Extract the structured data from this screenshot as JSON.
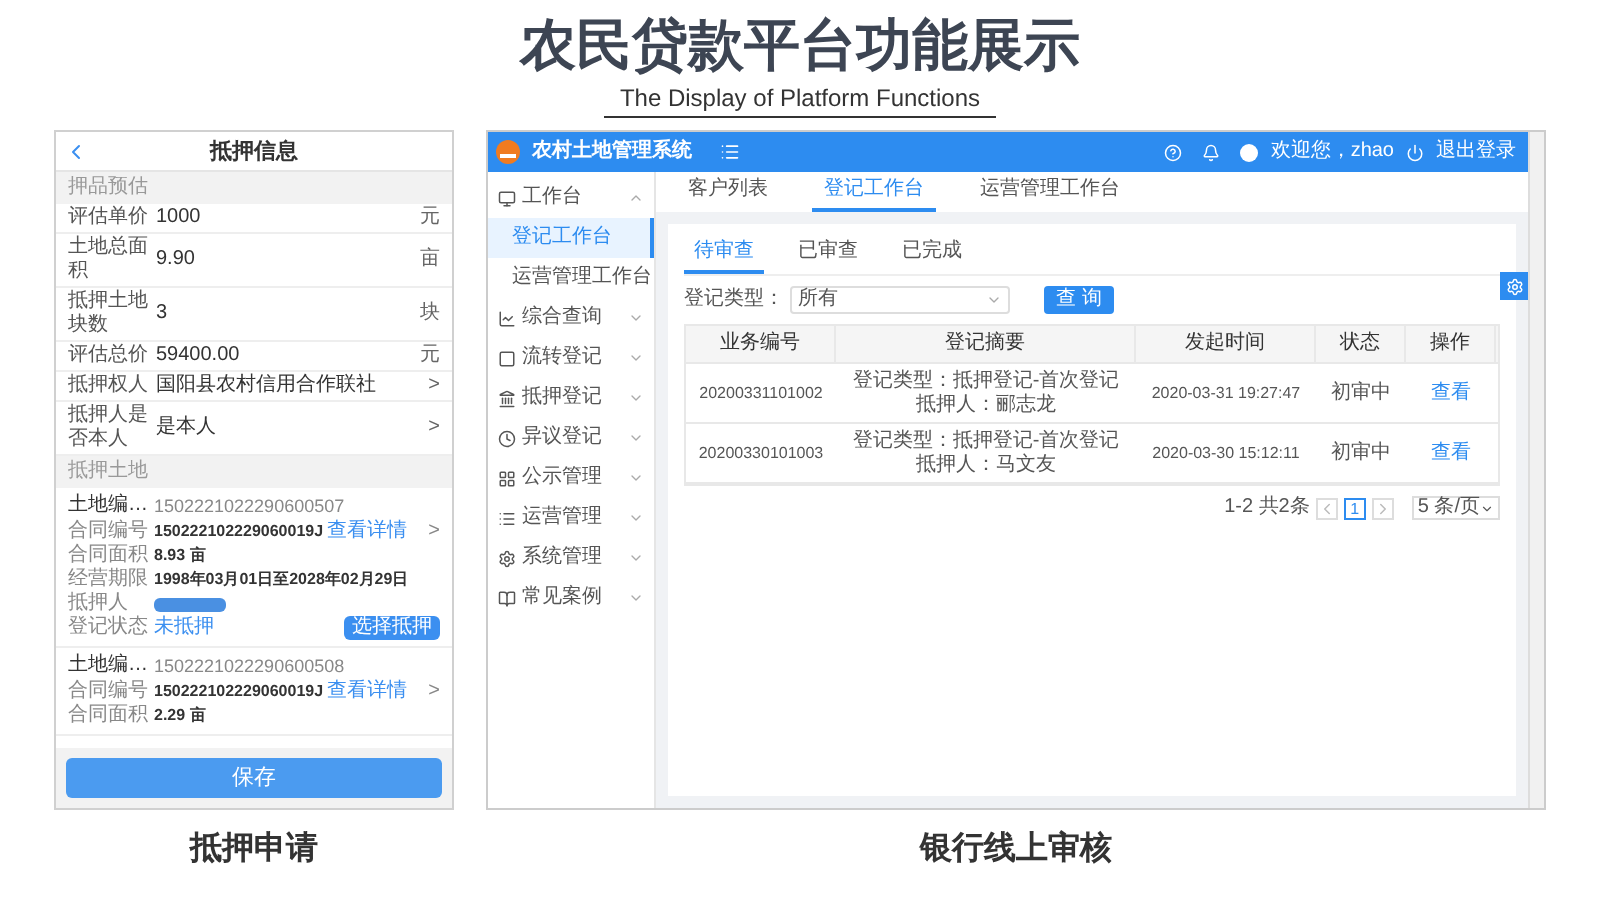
{
  "slide": {
    "title": "农民贷款平台功能展示",
    "subtitle": "The Display of Platform Functions"
  },
  "mobile": {
    "title": "抵押信息",
    "caption": "抵押申请",
    "estimate_heading": "押品预估",
    "fields": [
      {
        "label": "评估单价",
        "value": "1000",
        "unit": "元"
      },
      {
        "label": "土地总面积",
        "value": "9.90",
        "unit": "亩"
      },
      {
        "label": "抵押土地块数",
        "value": "3",
        "unit": "块"
      },
      {
        "label": "评估总价",
        "value": "59400.00",
        "unit": "元"
      },
      {
        "label": "抵押权人",
        "value": "国阳县农村信用合作联社",
        "unit": ">"
      },
      {
        "label": "抵押人是否本人",
        "value": "是本人",
        "unit": ">"
      }
    ],
    "lands_heading": "抵押土地",
    "lands": [
      {
        "label": "土地编…",
        "number": "1502221022290600507",
        "rows": [
          {
            "kind": "contract",
            "label": "合同编号",
            "value": "150222102229060019J",
            "link": "查看详情",
            "arrow": ">"
          },
          {
            "kind": "text",
            "label": "合同面积",
            "value": "8.93 亩"
          },
          {
            "kind": "text",
            "label": "经营期限",
            "value": "1998年03月01日至2028年02月29日"
          },
          {
            "kind": "redacted",
            "label": "抵押人"
          },
          {
            "kind": "status",
            "label": "登记状态",
            "value": "未抵押",
            "action": "选择抵押"
          }
        ]
      },
      {
        "label": "土地编…",
        "number": "1502221022290600508",
        "rows": [
          {
            "kind": "contract",
            "label": "合同编号",
            "value": "150222102229060019J",
            "link": "查看详情",
            "arrow": ">"
          },
          {
            "kind": "text",
            "label": "合同面积",
            "value": "2.29 亩"
          }
        ]
      }
    ],
    "save_button": "保存"
  },
  "web": {
    "caption": "银行线上审核",
    "logo": "农村土地管理系统",
    "user": "欢迎您，zhao",
    "logout": "退出登录",
    "sidebar": [
      {
        "label": "工作台",
        "expanded": true,
        "children": [
          {
            "label": "登记工作台",
            "selected": true
          },
          {
            "label": "运营管理工作台",
            "selected": false
          }
        ]
      },
      {
        "label": "综合查询",
        "expanded": false
      },
      {
        "label": "流转登记",
        "expanded": false
      },
      {
        "label": "抵押登记",
        "expanded": false
      },
      {
        "label": "异议登记",
        "expanded": false
      },
      {
        "label": "公示管理",
        "expanded": false
      },
      {
        "label": "运营管理",
        "expanded": false
      },
      {
        "label": "系统管理",
        "expanded": false
      },
      {
        "label": "常见案例",
        "expanded": false
      }
    ],
    "tabs": [
      {
        "label": "客户列表",
        "selected": false
      },
      {
        "label": "登记工作台",
        "selected": true
      },
      {
        "label": "运营管理工作台",
        "selected": false
      }
    ],
    "subtabs": [
      {
        "label": "待审查",
        "selected": true
      },
      {
        "label": "已审查",
        "selected": false
      },
      {
        "label": "已完成",
        "selected": false
      }
    ],
    "filter": {
      "label": "登记类型：",
      "value": "所有",
      "button": "查 询"
    },
    "table": {
      "columns": [
        "业务编号",
        "登记摘要",
        "发起时间",
        "状态",
        "操作"
      ],
      "rows": [
        {
          "id": "20200331101002",
          "summary": [
            "登记类型：抵押登记-首次登记",
            "抵押人：郦志龙"
          ],
          "time": "2020-03-31 19:27:47",
          "status": "初审中",
          "action": "查看"
        },
        {
          "id": "20200330101003",
          "summary": [
            "登记类型：抵押登记-首次登记",
            "抵押人：马文友"
          ],
          "time": "2020-03-30 15:12:11",
          "status": "初审中",
          "action": "查看"
        }
      ]
    },
    "pagination": {
      "summary": "1-2 共2条",
      "pages": [
        {
          "label": "1",
          "selected": true
        }
      ],
      "page_size": "5 条/页"
    }
  }
}
